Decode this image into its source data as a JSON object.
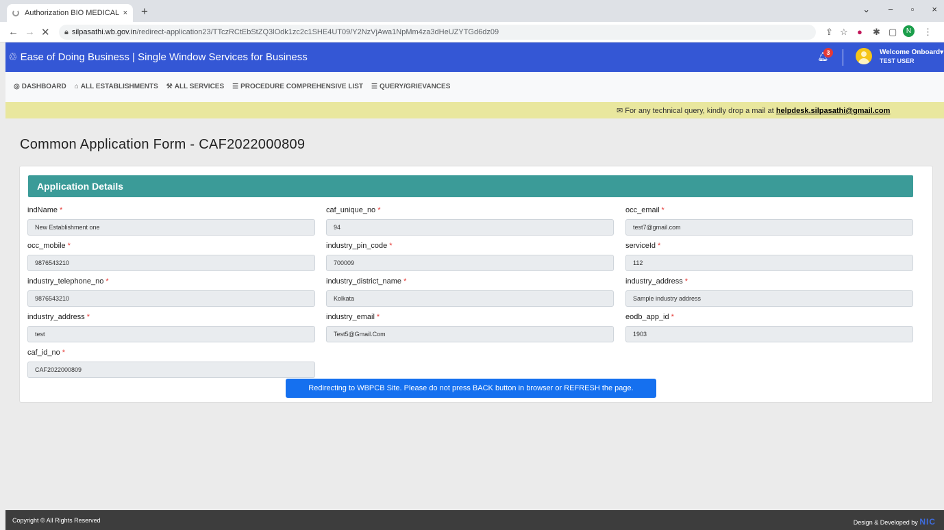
{
  "browser": {
    "tab_title": "Authorization BIO MEDICAL WAS",
    "tab_close": "×",
    "new_tab": "+",
    "win_minimize": "−",
    "win_restore": "▫",
    "win_close": "×",
    "win_dropdown": "⌄",
    "url_domain": "silpasathi.wb.gov.in",
    "url_path": "/redirect-application23/TTczRCtEbStZQ3lOdk1zc2c1SHE4UT09/Y2NzVjAwa1NpMm4za3dHeUZYTGd6dz09",
    "ext_profile_initial": "N"
  },
  "header": {
    "brand": "Ease of Doing Business | Single Window Services for Business",
    "notification_count": "3",
    "welcome": "Welcome Onboard",
    "user": "TEST USER"
  },
  "menu": {
    "items": [
      {
        "icon": "dashboard-icon",
        "label": "DASHBOARD"
      },
      {
        "icon": "building-icon",
        "label": "ALL ESTABLISHMENTS"
      },
      {
        "icon": "wrench-icon",
        "label": "ALL SERVICES"
      },
      {
        "icon": "list-icon",
        "label": "PROCEDURE COMPREHENSIVE LIST"
      },
      {
        "icon": "list-icon",
        "label": "QUERY/GRIEVANCES"
      }
    ]
  },
  "notice": {
    "text": "For any technical query, kindly drop a mail at",
    "email": "helpdesk.silpasathi@gmail.com"
  },
  "page": {
    "title": "Common Application Form - CAF2022000809"
  },
  "card": {
    "header": "Application Details",
    "fields": [
      {
        "label": "indName",
        "value": "New Establishment one"
      },
      {
        "label": "caf_unique_no",
        "value": "94"
      },
      {
        "label": "occ_email",
        "value": "test7@gmail.com"
      },
      {
        "label": "occ_mobile",
        "value": "9876543210"
      },
      {
        "label": "industry_pin_code",
        "value": "700009"
      },
      {
        "label": "serviceId",
        "value": "112"
      },
      {
        "label": "industry_telephone_no",
        "value": "9876543210"
      },
      {
        "label": "industry_district_name",
        "value": "Kolkata"
      },
      {
        "label": "industry_address",
        "value": "Sample industry address"
      },
      {
        "label": "industry_address",
        "value": "test"
      },
      {
        "label": "industry_email",
        "value": "Test5@Gmail.Com"
      },
      {
        "label": "eodb_app_id",
        "value": "1903"
      },
      {
        "label": "caf_id_no",
        "value": "CAF2022000809"
      }
    ],
    "required_mark": "*",
    "redirect_message": "Redirecting to WBPCB Site. Please do not press BACK button in browser or REFRESH the page."
  },
  "footer": {
    "copyright": "Copyright © All Rights Reserved",
    "designed": "Design & Developed by",
    "nic": "NIC"
  },
  "colors": {
    "topbar": "#3457d5",
    "card_header": "#3b9b98",
    "redirect_button": "#1570ef",
    "notice_bg": "#e9e79e",
    "required": "#e53935"
  }
}
